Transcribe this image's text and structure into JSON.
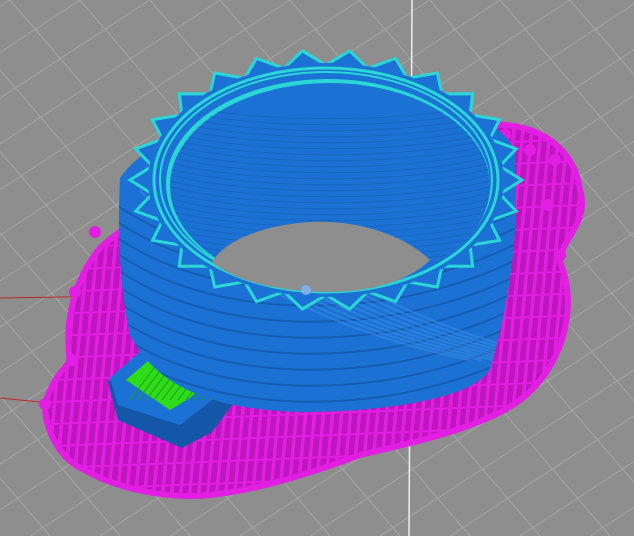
{
  "viewport": {
    "background": "#8e8e8e",
    "grid_color": "#a7a7a7",
    "axis_x_color": "#c0282a",
    "axis_z_color": "#ecf0f2"
  },
  "model": {
    "wall_color": "#1c72d4",
    "wall_shadow_color": "#1457a8",
    "perimeter_color": "#2ad6d6",
    "support_color": "#e21ee2",
    "support_dark_color": "#9c109c",
    "solid_infill_color": "#2edc1a",
    "seam_color": "#7fb0e8"
  }
}
